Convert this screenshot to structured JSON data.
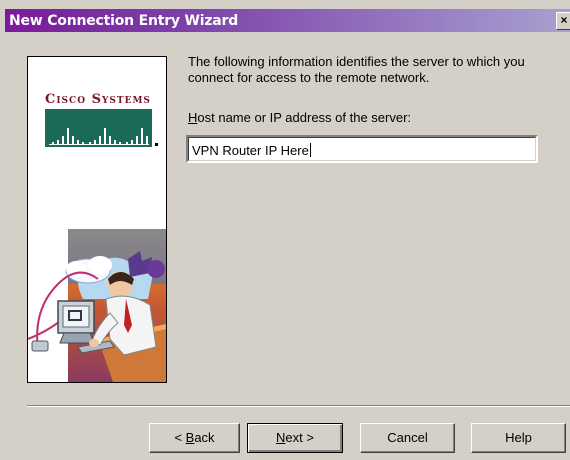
{
  "window": {
    "title": "New Connection Entry Wizard",
    "close_glyph": "×"
  },
  "left_panel": {
    "brand": "Cisco Systems",
    "brand_color": "#7a1426",
    "logo_color": "#1a6a5a"
  },
  "main": {
    "intro_text": "The following information identifies the server to which you connect for access to the remote network.",
    "host_label_prefix": "H",
    "host_label_rest": "ost name or IP address of the server:",
    "host_value": "VPN Router IP Here"
  },
  "buttons": {
    "back_prefix": "< ",
    "back_accel": "B",
    "back_rest": "ack",
    "next_accel": "N",
    "next_rest": "ext >",
    "cancel": "Cancel",
    "help": "Help"
  },
  "colors": {
    "titlebar_start": "#7a1a9a",
    "titlebar_end": "#a8a0d0",
    "dialog_bg": "#d4d0c8"
  }
}
